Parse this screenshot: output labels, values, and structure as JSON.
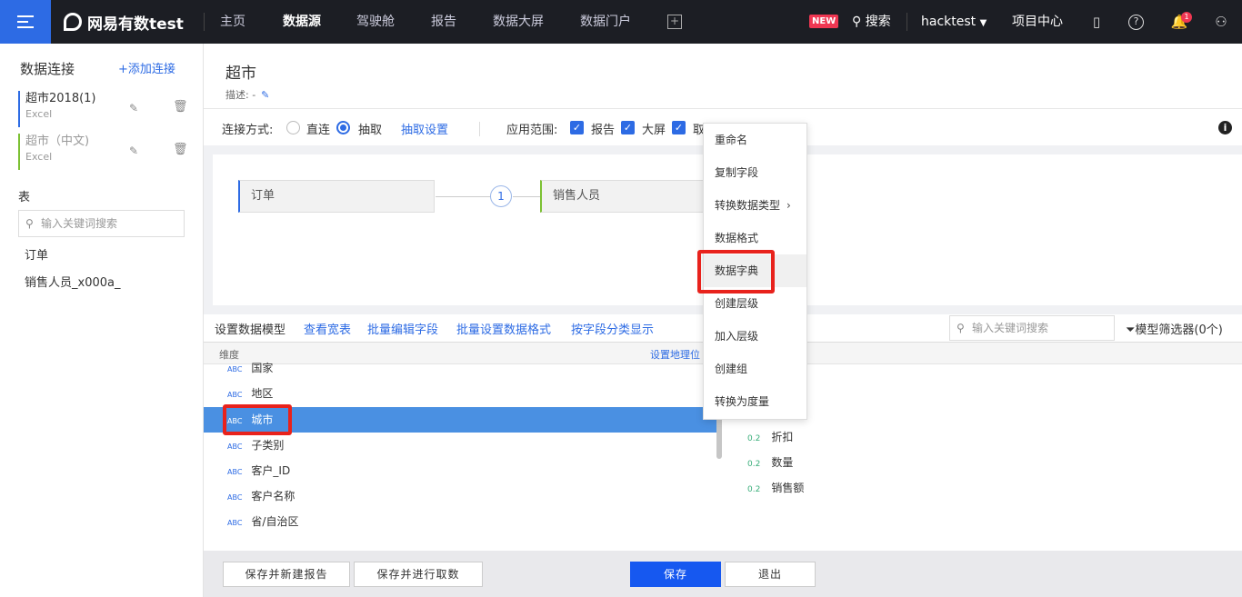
{
  "topbar": {
    "logo": "网易有数test",
    "nav": [
      "主页",
      "数据源",
      "驾驶舱",
      "报告",
      "数据大屏",
      "数据门户"
    ],
    "active_nav": "数据源",
    "new_badge": "NEW",
    "search": "搜索",
    "user": "hacktest",
    "project_center": "项目中心",
    "notif_count": "1",
    "icons": [
      "menu-icon",
      "logo-icon",
      "add-icon",
      "search-icon",
      "caret-down-icon",
      "bookmark-icon",
      "help-icon",
      "bell-icon",
      "user-icon"
    ]
  },
  "sidebar": {
    "title": "数据连接",
    "add": "+添加连接",
    "connections": [
      {
        "name": "超市2018(1)",
        "type": "Excel",
        "color": "#2d6be4"
      },
      {
        "name": "超市（中文)",
        "type": "Excel",
        "color": "#7cc133"
      }
    ],
    "tables_label": "表",
    "search_placeholder": "输入关键词搜索",
    "tables": [
      "订单",
      "销售人员_x000a_"
    ]
  },
  "header": {
    "title": "超市",
    "desc": "描述: -"
  },
  "config": {
    "conn_label": "连接方式:",
    "direct": "直连",
    "extract": "抽取",
    "extract_settings": "抽取设置",
    "scope_label": "应用范围:",
    "report": "报告",
    "screen": "大屏",
    "cockpit": "取"
  },
  "model": {
    "node_left": "订单",
    "node_right": "销售人员",
    "link_count": "1"
  },
  "toolbar": {
    "setup": "设置数据模型",
    "view_wide": "查看宽表",
    "batch_edit": "批量编辑字段",
    "batch_format": "批量设置数据格式",
    "group_by": "按字段分类显示",
    "search_placeholder": "输入关键词搜索",
    "filter": "模型筛选器(0个)"
  },
  "fields": {
    "dim_header": "维度",
    "geo_link": "设置地理位",
    "type_tag": "ABC",
    "measure_tag": "0.2",
    "dimensions": [
      "国家",
      "地区",
      "城市",
      "子类别",
      "客户_ID",
      "客户名称",
      "省/自治区"
    ],
    "selected": "城市",
    "measures": [
      "折扣",
      "数量",
      "销售额"
    ]
  },
  "context_menu": {
    "items": [
      "重命名",
      "复制字段",
      "转换数据类型",
      "数据格式",
      "数据字典",
      "创建层级",
      "加入层级",
      "创建组",
      "转换为度量"
    ],
    "highlighted": "数据字典"
  },
  "footer": {
    "save_new_report": "保存并新建报告",
    "save_extract": "保存并进行取数",
    "save": "保存",
    "exit": "退出"
  },
  "colors": {
    "accent": "#2d6be4",
    "topbar": "#1c1e24",
    "highlight": "#e8221c",
    "selected_row": "#4a90e2"
  }
}
